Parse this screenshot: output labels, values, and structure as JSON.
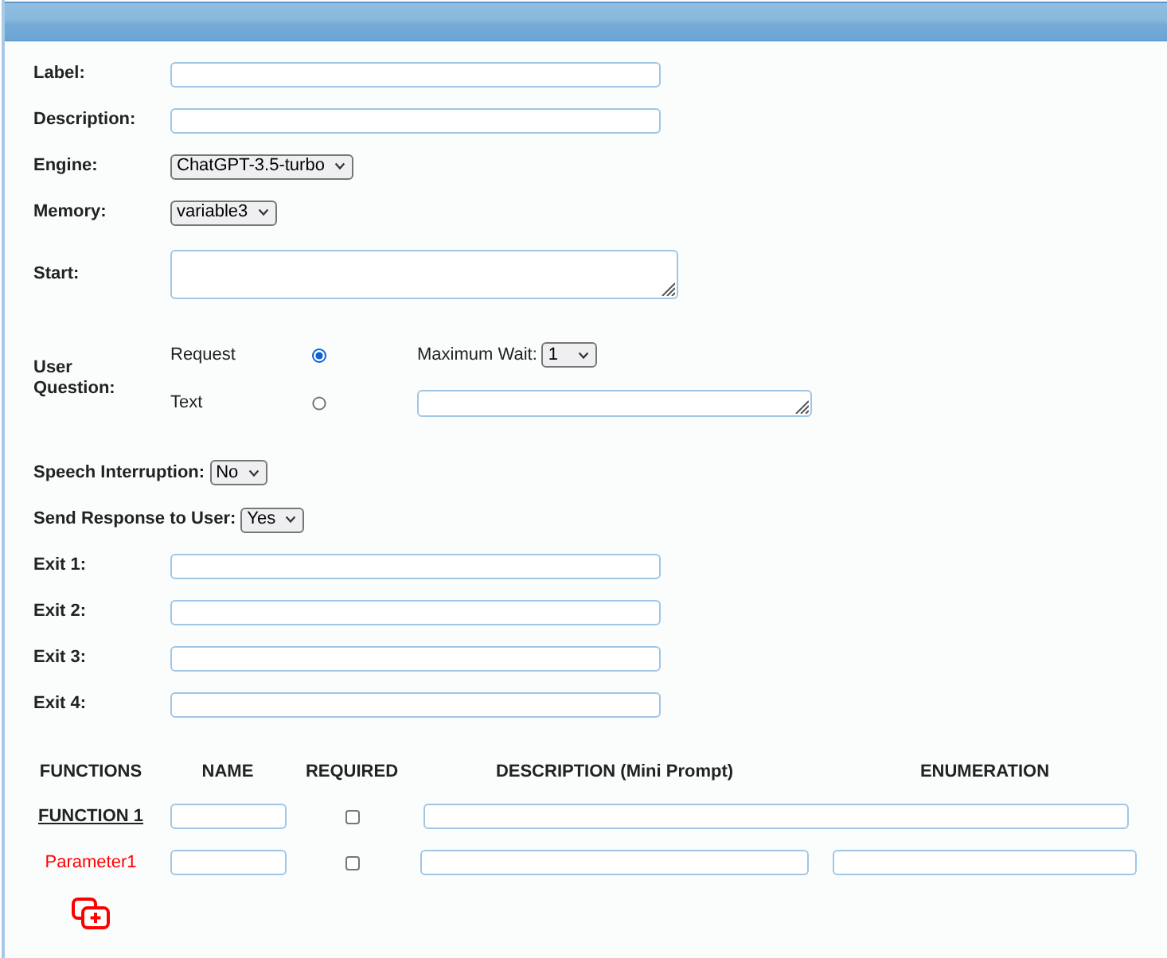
{
  "fields": [
    {
      "kind": "text",
      "label": "Label:"
    },
    {
      "kind": "text",
      "label": "Description:"
    },
    {
      "kind": "select",
      "label": "Engine:",
      "value": "ChatGPT-3.5-turbo"
    },
    {
      "kind": "select",
      "label": "Memory:",
      "value": "variable3"
    },
    {
      "kind": "textarea",
      "label": "Start:"
    }
  ],
  "user_question": {
    "label": "User Question:",
    "options": [
      {
        "label": "Request",
        "selected": true,
        "kind": "select",
        "field_label": "Maximum Wait:",
        "value": "1"
      },
      {
        "label": "Text",
        "selected": false,
        "kind": "textarea"
      }
    ]
  },
  "settings": [
    {
      "label": "Speech Interruption:",
      "value": "No"
    },
    {
      "label": "Send Response to User:",
      "value": "Yes"
    }
  ],
  "exits": [
    {
      "label": "Exit 1:"
    },
    {
      "label": "Exit 2:"
    },
    {
      "label": "Exit 3:"
    },
    {
      "label": "Exit 4:"
    }
  ],
  "functions": {
    "columns": [
      "FUNCTIONS",
      "NAME",
      "REQUIRED",
      "DESCRIPTION (Mini Prompt)",
      "ENUMERATION"
    ],
    "rows": [
      {
        "kind": "function",
        "label": "FUNCTION 1",
        "required": false
      },
      {
        "kind": "parameter",
        "label": "Parameter1",
        "required": false
      }
    ]
  }
}
